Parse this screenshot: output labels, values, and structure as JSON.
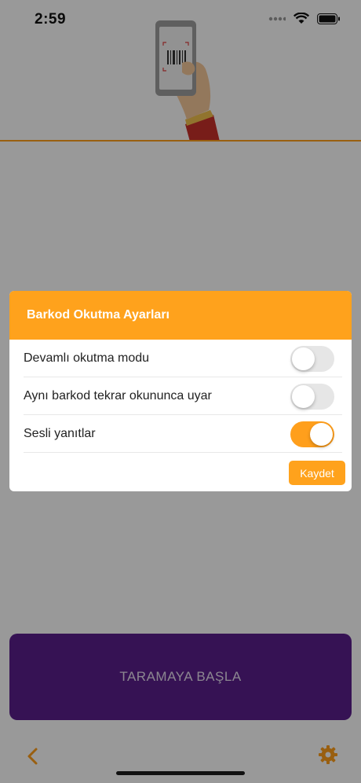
{
  "status_bar": {
    "time": "2:59"
  },
  "main": {
    "scan_button_label": "TARAMAYA BAŞLA"
  },
  "dialog": {
    "title": "Barkod Okutma Ayarları",
    "settings": [
      {
        "label": "Devamlı okutma modu",
        "enabled": false
      },
      {
        "label": "Aynı barkod tekrar okununca uyar",
        "enabled": false
      },
      {
        "label": "Sesli yanıtlar",
        "enabled": true
      }
    ],
    "save_label": "Kaydet"
  },
  "icons": {
    "back": "chevron-left-icon",
    "settings": "gear-icon",
    "illustration": "phone-barcode-scan-illustration"
  },
  "colors": {
    "accent": "#ffa21c",
    "primary_button": "#5a1f8c",
    "overlay": "rgba(0,0,0,0.40)"
  }
}
